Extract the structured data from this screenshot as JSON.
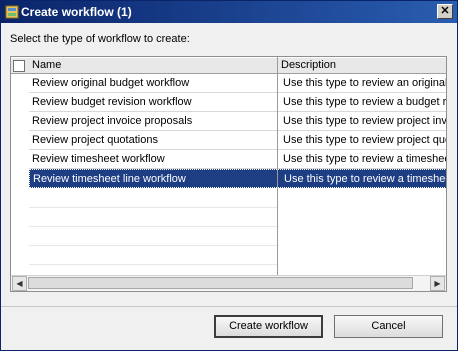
{
  "window": {
    "title": "Create workflow (1)",
    "close_glyph": "✕"
  },
  "instruction": "Select the type of workflow to create:",
  "table": {
    "columns": [
      "Name",
      "Description"
    ],
    "rows": [
      {
        "name": "Review original budget workflow",
        "description": "Use this type to review an original budget"
      },
      {
        "name": "Review budget revision workflow",
        "description": "Use this type to review a budget revision"
      },
      {
        "name": "Review project invoice proposals",
        "description": "Use this type to review project invoice proposals"
      },
      {
        "name": "Review project quotations",
        "description": "Use this type to review project quotations"
      },
      {
        "name": "Review timesheet workflow",
        "description": "Use this type to review a timesheet"
      },
      {
        "name": "Review timesheet line workflow",
        "description": "Use this type to review a timesheet line",
        "selected": true
      }
    ]
  },
  "buttons": {
    "create": "Create workflow",
    "cancel": "Cancel"
  },
  "scroll": {
    "left": "◀",
    "right": "▶"
  }
}
